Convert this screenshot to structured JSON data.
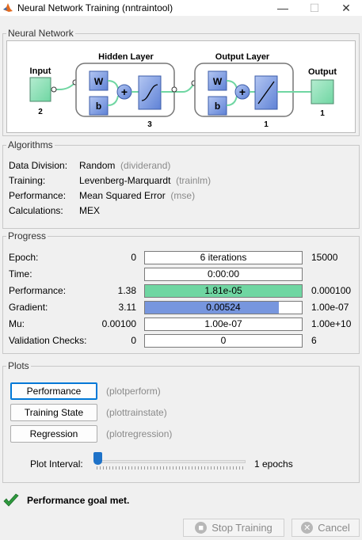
{
  "window": {
    "title": "Neural Network Training (nntraintool)",
    "min_glyph": "—",
    "max_glyph": "☐",
    "close_glyph": "✕"
  },
  "network": {
    "panel_title": "Neural Network",
    "input_label": "Input",
    "input_size": "2",
    "hidden_label": "Hidden Layer",
    "hidden_size": "3",
    "output_layer_label": "Output Layer",
    "output_layer_size": "1",
    "output_label": "Output",
    "output_size": "1",
    "weight_label": "W",
    "bias_label": "b",
    "sum_glyph": "+"
  },
  "algorithms": {
    "panel_title": "Algorithms",
    "rows": [
      {
        "label": "Data Division:",
        "value": "Random",
        "hint": "(dividerand)"
      },
      {
        "label": "Training:",
        "value": "Levenberg-Marquardt",
        "hint": "(trainlm)"
      },
      {
        "label": "Performance:",
        "value": "Mean Squared Error",
        "hint": "(mse)"
      },
      {
        "label": "Calculations:",
        "value": "MEX",
        "hint": ""
      }
    ]
  },
  "progress": {
    "panel_title": "Progress",
    "rows": [
      {
        "label": "Epoch:",
        "start": "0",
        "current": "6 iterations",
        "end": "15000",
        "fill": 0,
        "color": ""
      },
      {
        "label": "Time:",
        "start": "",
        "current": "0:00:00",
        "end": "",
        "fill": 0,
        "color": ""
      },
      {
        "label": "Performance:",
        "start": "1.38",
        "current": "1.81e-05",
        "end": "0.000100",
        "fill": 1.0,
        "color": "#6fd6a2"
      },
      {
        "label": "Gradient:",
        "start": "3.11",
        "current": "0.00524",
        "end": "1.00e-07",
        "fill": 0.855,
        "color": "#7796de"
      },
      {
        "label": "Mu:",
        "start": "0.00100",
        "current": "1.00e-07",
        "end": "1.00e+10",
        "fill": 0,
        "color": ""
      },
      {
        "label": "Validation Checks:",
        "start": "0",
        "current": "0",
        "end": "6",
        "fill": 0,
        "color": ""
      }
    ]
  },
  "plots": {
    "panel_title": "Plots",
    "buttons": [
      {
        "label": "Performance",
        "hint": "(plotperform)"
      },
      {
        "label": "Training State",
        "hint": "(plottrainstate)"
      },
      {
        "label": "Regression",
        "hint": "(plotregression)"
      }
    ],
    "interval_label": "Plot Interval:",
    "interval_value": "1 epochs",
    "interval_fraction": 0.0
  },
  "status": {
    "message": "Performance goal met."
  },
  "footer": {
    "stop_label": "Stop Training",
    "cancel_label": "Cancel"
  }
}
